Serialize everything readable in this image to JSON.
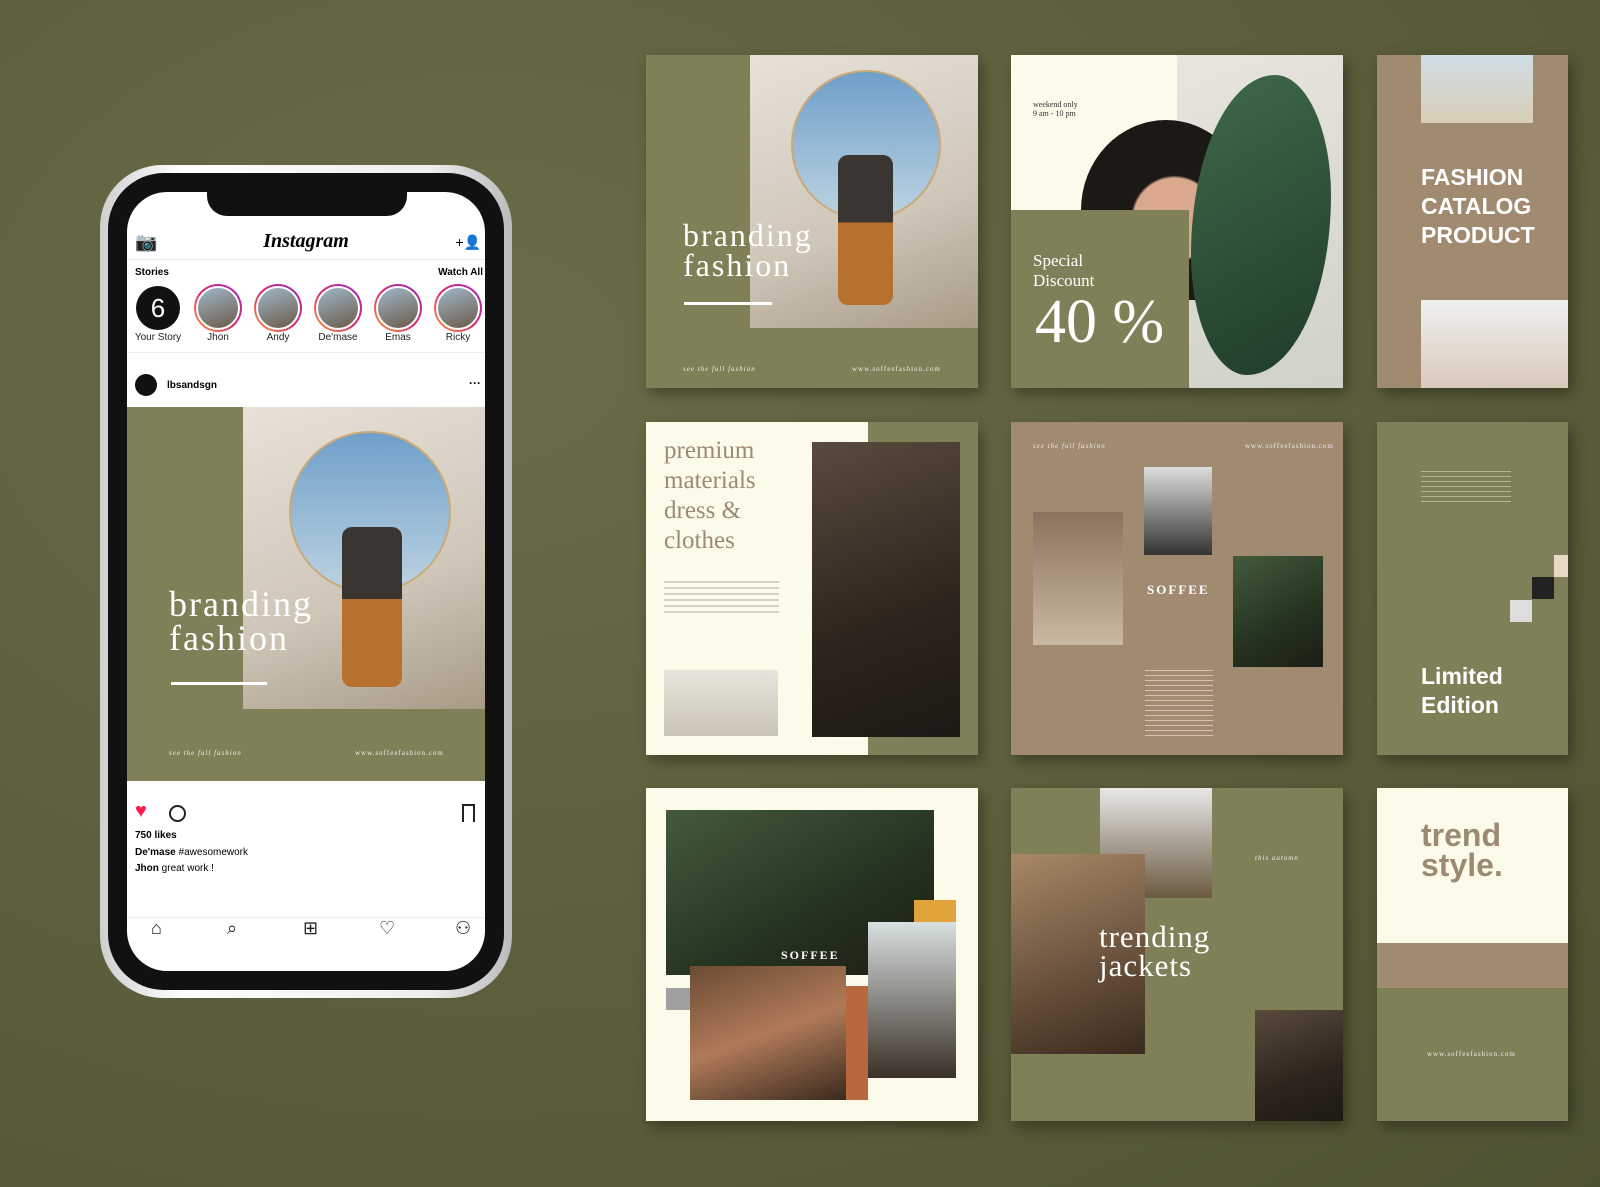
{
  "phone": {
    "app_title": "Instagram",
    "stories_label": "Stories",
    "watch_all": "Watch All",
    "stories": [
      {
        "name": "Your Story"
      },
      {
        "name": "Jhon"
      },
      {
        "name": "Andy"
      },
      {
        "name": "De'mase"
      },
      {
        "name": "Emas"
      },
      {
        "name": "Ricky"
      }
    ],
    "post": {
      "username": "lbsandsgn",
      "more": "···",
      "headline1": "branding",
      "headline2": "fashion",
      "footer_left": "see the full fashion",
      "footer_right": "www.soffeefashion.com",
      "likes": "750 likes",
      "caption_user": "De'mase",
      "caption_text": "#awesomework",
      "comment_user": "Jhon",
      "comment_text": "great work !"
    },
    "colors": {
      "like": "#ff1a4b",
      "post_bg": "#7f8058"
    }
  },
  "templates": {
    "c1": {
      "title1": "branding",
      "title2": "fashion",
      "footer_left": "see the full fashion",
      "footer_right": "www.soffeefashion.com"
    },
    "c2": {
      "note1": "weekend only",
      "note2": "9 am - 10 pm",
      "label1": "Special",
      "label2": "Discount",
      "value": "40 %"
    },
    "c3": {
      "title": [
        "FASHION",
        "CATALOG",
        "PRODUCT"
      ]
    },
    "c4": {
      "title": [
        "premium",
        "materials",
        "dress &",
        "clothes"
      ]
    },
    "c5": {
      "header_left": "see the full fashion",
      "header_right": "www.soffeefashion.com",
      "brand": "SOFFEE"
    },
    "c6": {
      "title": [
        "Limited",
        "Edition"
      ]
    },
    "c7": {
      "brand": "SOFFEE"
    },
    "c8": {
      "note": "this autumn",
      "title1": "trending",
      "title2": "jackets"
    },
    "c9": {
      "title1": "trend",
      "title2": "style.",
      "footer": "www.soffeefashion.com"
    }
  },
  "colors": {
    "background": "#5c5f3c",
    "olive": "#7f8058",
    "tan": "#a08a70",
    "cream": "#fcfbe9"
  }
}
